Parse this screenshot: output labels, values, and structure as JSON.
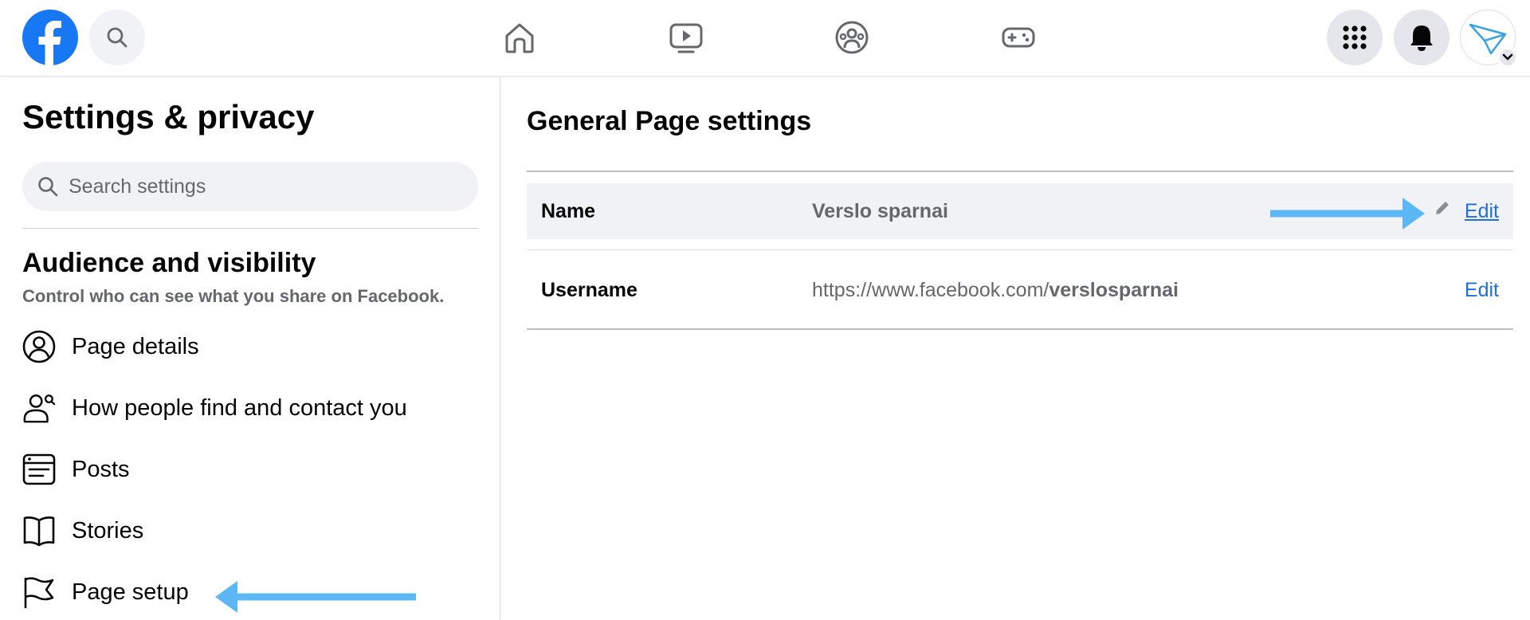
{
  "colors": {
    "brand": "#1877f2",
    "link": "#216fdb",
    "annotation_arrow": "#5bb8f5",
    "secondary_text": "#65676b"
  },
  "topbar": {
    "logo": "facebook-logo",
    "nav_icons": [
      "home-icon",
      "watch-icon",
      "groups-icon",
      "gaming-icon"
    ],
    "right_icons": [
      "menu-grid-icon",
      "notifications-bell-icon",
      "avatar"
    ]
  },
  "sidebar": {
    "title": "Settings & privacy",
    "search_placeholder": "Search settings",
    "section": {
      "title": "Audience and visibility",
      "description": "Control who can see what you share on Facebook."
    },
    "items": [
      {
        "label": "Page details",
        "icon": "person-circle-icon"
      },
      {
        "label": "How people find and contact you",
        "icon": "person-search-icon"
      },
      {
        "label": "Posts",
        "icon": "posts-icon"
      },
      {
        "label": "Stories",
        "icon": "book-icon"
      },
      {
        "label": "Page setup",
        "icon": "flag-icon"
      }
    ]
  },
  "main": {
    "title": "General Page settings",
    "rows": [
      {
        "label": "Name",
        "value": "Verslo sparnai",
        "edit": "Edit"
      },
      {
        "label": "Username",
        "value_prefix": "https://www.facebook.com/",
        "value_bold": "verslosparnai",
        "edit": "Edit"
      }
    ]
  }
}
